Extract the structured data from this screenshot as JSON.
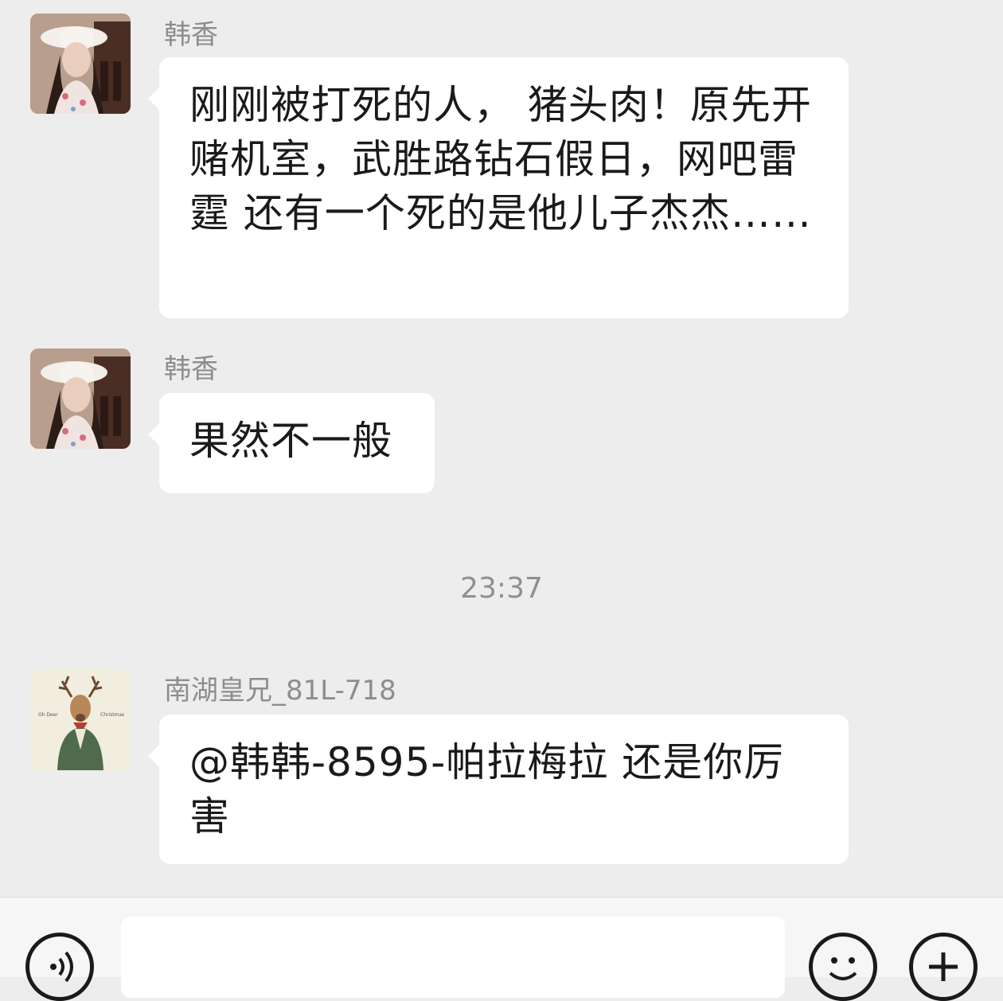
{
  "messages": [
    {
      "sender": "韩香",
      "text": "刚刚被打死的人， 猪头肉！原先开赌机室，武胜路钻石假日，网吧雷霆 还有一个死的是他儿子杰杰……",
      "avatar": "woman-photo-avatar"
    },
    {
      "sender": "韩香",
      "text": "果然不一般",
      "avatar": "woman-photo-avatar"
    },
    {
      "sender": "南湖皇兄_81L-718",
      "text": "@韩韩-8595-帕拉梅拉  还是你厉害",
      "avatar": "deer-illustration-avatar"
    }
  ],
  "timestamp": "23:37",
  "input_bar": {
    "voice_icon": "voice-icon",
    "emoji_icon": "emoji-icon",
    "plus_icon": "plus-icon",
    "input_value": ""
  }
}
